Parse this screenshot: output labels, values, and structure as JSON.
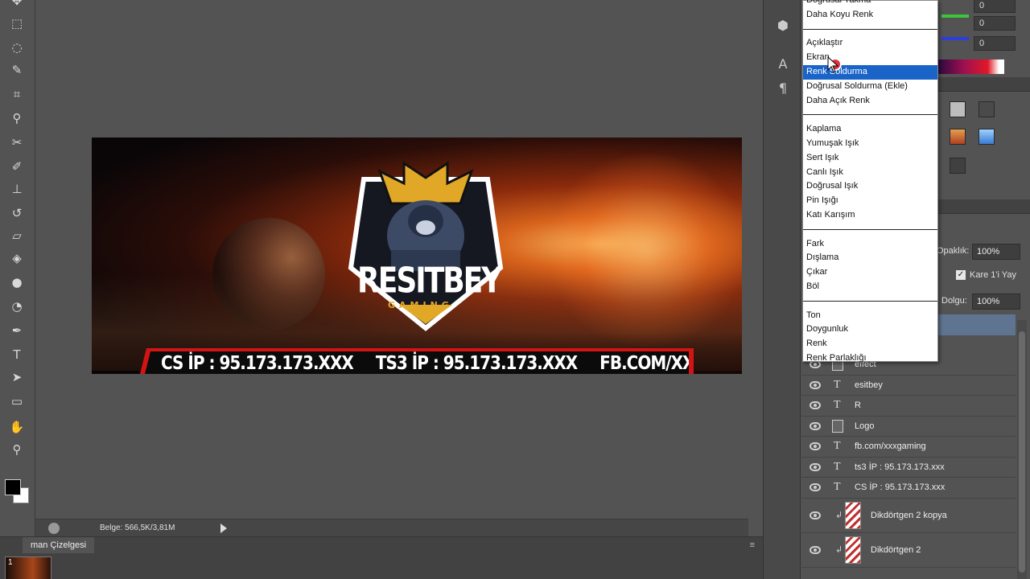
{
  "tools": [
    {
      "name": "move-tool-icon",
      "glyph": "✥"
    },
    {
      "name": "marquee-tool-icon",
      "glyph": "⬚"
    },
    {
      "name": "lasso-tool-icon",
      "glyph": "◌"
    },
    {
      "name": "quick-selection-icon",
      "glyph": "✎"
    },
    {
      "name": "crop-tool-icon",
      "glyph": "⌗"
    },
    {
      "name": "eyedropper-icon",
      "glyph": "⚲"
    },
    {
      "name": "healing-brush-icon",
      "glyph": "✂"
    },
    {
      "name": "brush-tool-icon",
      "glyph": "✐"
    },
    {
      "name": "clone-stamp-icon",
      "glyph": "⊥"
    },
    {
      "name": "history-brush-icon",
      "glyph": "↺"
    },
    {
      "name": "eraser-tool-icon",
      "glyph": "▱"
    },
    {
      "name": "paint-bucket-icon",
      "glyph": "◈"
    },
    {
      "name": "blur-tool-icon",
      "glyph": "●"
    },
    {
      "name": "dodge-tool-icon",
      "glyph": "◔"
    },
    {
      "name": "pen-tool-icon",
      "glyph": "✒"
    },
    {
      "name": "type-tool-icon",
      "glyph": "T"
    },
    {
      "name": "path-selection-icon",
      "glyph": "➤"
    },
    {
      "name": "rectangle-tool-icon",
      "glyph": "▭"
    },
    {
      "name": "hand-tool-icon",
      "glyph": "✋"
    },
    {
      "name": "zoom-tool-icon",
      "glyph": "⚲"
    }
  ],
  "canvas": {
    "brand_name": "RESITBEY",
    "brand_sub": "GAMING",
    "banner": [
      "CS İP : 95.173.173.XXX",
      "TS3 İP : 95.173.173.XXX",
      "FB.COM/XXXGAMING"
    ]
  },
  "status": {
    "document_info": "Belge: 566,5K/3,81M"
  },
  "timeline": {
    "tab_label": "man Çizelgesi",
    "frame_number": "1"
  },
  "color_panel": {
    "values": [
      "0",
      "0",
      "0"
    ]
  },
  "layers_panel": {
    "opacity_label": "Opaklık:",
    "opacity_value": "100%",
    "propagate_label": "Kare 1'i Yay",
    "fill_label": "Dolgu:",
    "fill_value": "100%",
    "layers": [
      {
        "kind": "smart",
        "label": "effect"
      },
      {
        "kind": "type",
        "label": "esitbey"
      },
      {
        "kind": "type",
        "label": "R"
      },
      {
        "kind": "smart",
        "label": "Logo"
      },
      {
        "kind": "type",
        "label": "fb.com/xxxgaming"
      },
      {
        "kind": "type",
        "label": "ts3 İP : 95.173.173.xxx"
      },
      {
        "kind": "type",
        "label": "CS İP : 95.173.173.xxx"
      },
      {
        "kind": "shape",
        "label": "Dikdörtgen 2 kopya"
      },
      {
        "kind": "shape",
        "label": "Dikdörtgen 2"
      }
    ]
  },
  "blend_menu": {
    "top_partial": "Doğrusal Yakma",
    "groups": [
      [
        "Daha Koyu Renk"
      ],
      [
        "Açıklaştır",
        "Ekran",
        "Renk Soldurma",
        "Doğrusal Soldurma (Ekle)",
        "Daha Açık Renk"
      ],
      [
        "Kaplama",
        "Yumuşak Işık",
        "Sert Işık",
        "Canlı Işık",
        "Doğrusal Işık",
        "Pin Işığı",
        "Katı Karışım"
      ],
      [
        "Fark",
        "Dışlama",
        "Çıkar",
        "Böl"
      ],
      [
        "Ton",
        "Doygunluk",
        "Renk",
        "Renk Parlaklığı"
      ]
    ],
    "selected": "Renk Soldurma",
    "selected_color": "#1a64c8"
  }
}
